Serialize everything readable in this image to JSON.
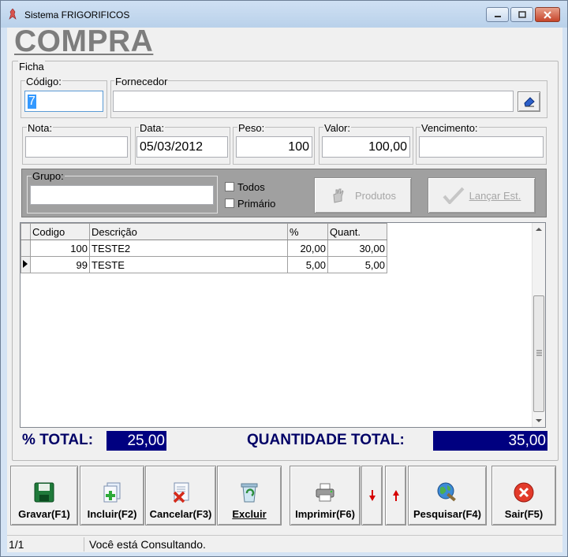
{
  "window": {
    "title": "Sistema FRIGORIFICOS"
  },
  "heading": "COMPRA",
  "ficha": {
    "legend": "Ficha",
    "codigo": {
      "label": "Código:",
      "value": "7"
    },
    "fornecedor": {
      "label": "Fornecedor",
      "value": ""
    },
    "nota": {
      "label": "Nota:",
      "value": ""
    },
    "data": {
      "label": "Data:",
      "value": "05/03/2012"
    },
    "peso": {
      "label": "Peso:",
      "value": "100"
    },
    "valor": {
      "label": "Valor:",
      "value": "100,00"
    },
    "vencimento": {
      "label": "Vencimento:",
      "value": ""
    },
    "grupo": {
      "label": "Grupo:",
      "value": ""
    },
    "todos_label": "Todos",
    "primario_label": "Primário",
    "produtos_label": "Produtos",
    "lancar_label": "Lançar Est."
  },
  "grid": {
    "headers": [
      "Codigo",
      "Descrição",
      "%",
      "Quant."
    ],
    "rows": [
      {
        "codigo": "100",
        "descricao": "TESTE2",
        "pct": "20,00",
        "quant": "30,00"
      },
      {
        "codigo": "99",
        "descricao": "TESTE",
        "pct": "5,00",
        "quant": "5,00"
      }
    ]
  },
  "totals": {
    "pct_label": "% TOTAL:",
    "pct_value": "25,00",
    "qtd_label": "QUANTIDADE TOTAL:",
    "qtd_value": "35,00"
  },
  "toolbar": {
    "gravar": "Gravar(F1)",
    "incluir": "Incluir(F2)",
    "cancelar": "Cancelar(F3)",
    "excluir": "Excluir",
    "imprimir": "Imprimir(F6)",
    "pesquisar": "Pesquisar(F4)",
    "sair": "Sair(F5)"
  },
  "status": {
    "record": "1/1",
    "message": "Você está Consultando."
  },
  "colors": {
    "accent": "#000080",
    "heading": "#7d7d7d"
  }
}
